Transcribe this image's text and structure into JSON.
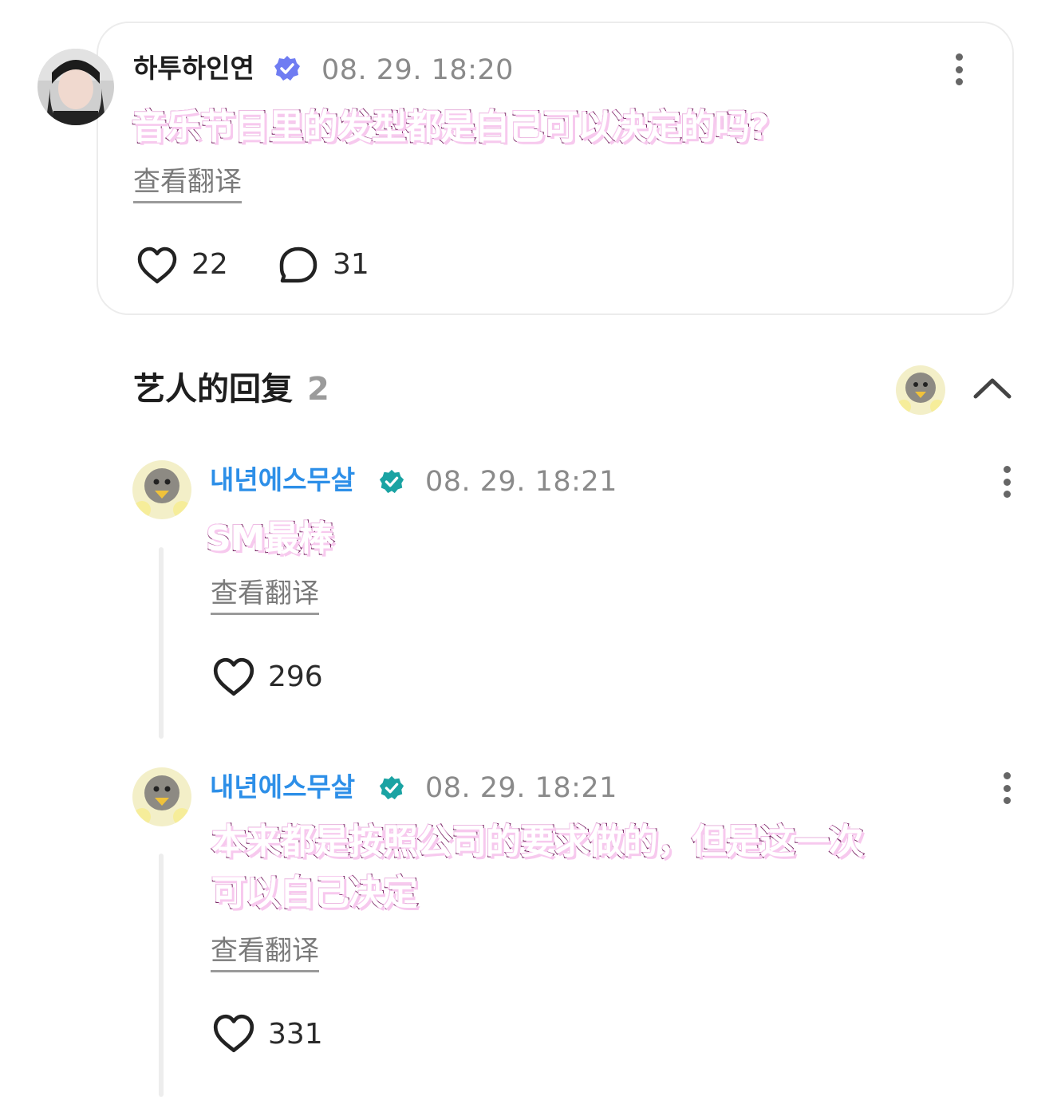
{
  "post": {
    "username": "하투하인연",
    "timestamp": "08. 29. 18:20",
    "text": "音乐节目里的发型都是自己可以决定的吗?",
    "translate_label": "查看翻译",
    "likes": "22",
    "comments": "31",
    "accent_badge_color": "#6f7cf2"
  },
  "replies_section": {
    "title": "艺人的回复",
    "count": "2"
  },
  "replies": [
    {
      "username": "내년에스무살",
      "timestamp": "08. 29. 18:21",
      "text_lines": [
        "SM最棒"
      ],
      "translate_label": "查看翻译",
      "likes": "296"
    },
    {
      "username": "내년에스무살",
      "timestamp": "08. 29. 18:21",
      "text_lines": [
        "本来都是按照公司的要求做的，但是这一次",
        "可以自己决定"
      ],
      "translate_label": "查看翻译",
      "likes": "331"
    }
  ],
  "colors": {
    "artist_name": "#2d8fe8",
    "artist_badge": "#1aa3a3",
    "overlay_fill": "#ffffff",
    "overlay_stroke": "#7a2a66"
  }
}
